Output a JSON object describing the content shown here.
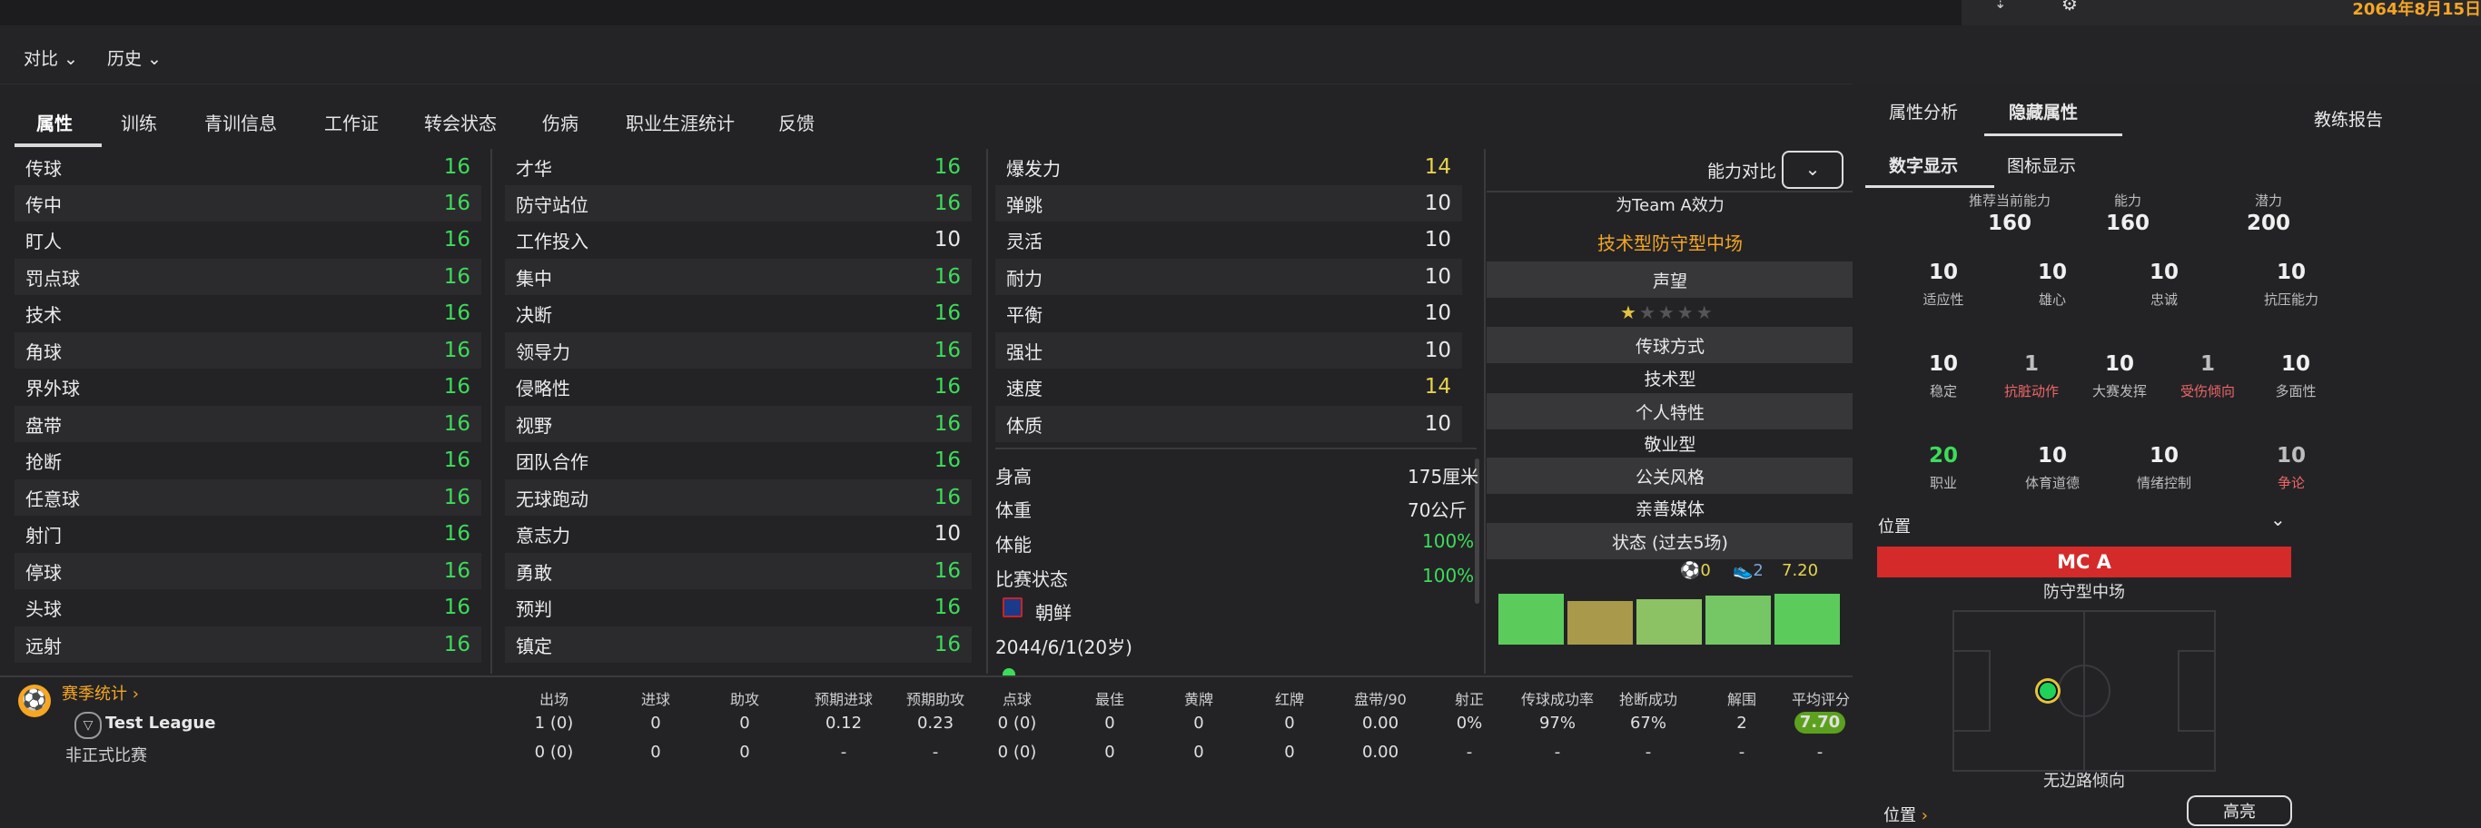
{
  "header": {
    "date": "2064年8月15日"
  },
  "subnav": {
    "compare": "对比",
    "history": "历史"
  },
  "tabs": [
    "属性",
    "训练",
    "青训信息",
    "工作证",
    "转会状态",
    "伤病",
    "职业生涯统计",
    "反馈"
  ],
  "attr_col1": [
    [
      "传球",
      "16"
    ],
    [
      "传中",
      "16"
    ],
    [
      "盯人",
      "16"
    ],
    [
      "罚点球",
      "16"
    ],
    [
      "技术",
      "16"
    ],
    [
      "角球",
      "16"
    ],
    [
      "界外球",
      "16"
    ],
    [
      "盘带",
      "16"
    ],
    [
      "抢断",
      "16"
    ],
    [
      "任意球",
      "16"
    ],
    [
      "射门",
      "16"
    ],
    [
      "停球",
      "16"
    ],
    [
      "头球",
      "16"
    ],
    [
      "远射",
      "16"
    ]
  ],
  "attr_col2": [
    [
      "才华",
      "16"
    ],
    [
      "防守站位",
      "16"
    ],
    [
      "工作投入",
      "10"
    ],
    [
      "集中",
      "16"
    ],
    [
      "决断",
      "16"
    ],
    [
      "领导力",
      "16"
    ],
    [
      "侵略性",
      "16"
    ],
    [
      "视野",
      "16"
    ],
    [
      "团队合作",
      "16"
    ],
    [
      "无球跑动",
      "16"
    ],
    [
      "意志力",
      "10"
    ],
    [
      "勇敢",
      "16"
    ],
    [
      "预判",
      "16"
    ],
    [
      "镇定",
      "16"
    ]
  ],
  "attr_col3": [
    [
      "爆发力",
      "14"
    ],
    [
      "弹跳",
      "10"
    ],
    [
      "灵活",
      "10"
    ],
    [
      "耐力",
      "10"
    ],
    [
      "平衡",
      "10"
    ],
    [
      "强壮",
      "10"
    ],
    [
      "速度",
      "14"
    ],
    [
      "体质",
      "10"
    ]
  ],
  "physical": {
    "height_label": "身高",
    "height": "175厘米",
    "weight_label": "体重",
    "weight": "70公斤",
    "fitness_label": "体能",
    "fitness": "100%",
    "match_label": "比赛状态",
    "match": "100%",
    "nation": "朝鲜",
    "dob": "2044/6/1(20岁)"
  },
  "panel": {
    "compare_label": "能力对比",
    "team_line": "为Team A效力",
    "role": "技术型防守型中场",
    "rep_label": "声望",
    "pass_label": "传球方式",
    "pass_value": "技术型",
    "trait_label": "个人特性",
    "trait_value": "敬业型",
    "media_label": "公关风格",
    "media_value": "亲善媒体",
    "form_label": "状态 (过去5场)",
    "form_goals": "0",
    "form_assists": "2",
    "form_rating": "7.20",
    "reputation_stars": 0.5,
    "form_bars": [
      0.7,
      0.55,
      0.6,
      0.65,
      0.7
    ]
  },
  "right": {
    "tab_attr_analysis": "属性分析",
    "tab_hidden": "隐藏属性",
    "coach_report": "教练报告",
    "sub_num": "数字显示",
    "sub_icon": "图标显示",
    "ca_label": "推荐当前能力",
    "ca": "160",
    "ability_label": "能力",
    "ability": "160",
    "potential_label": "潜力",
    "potential": "200",
    "hidden": [
      [
        "10",
        "适应性"
      ],
      [
        "10",
        "雄心"
      ],
      [
        "10",
        "忠诚"
      ],
      [
        "10",
        "抗压能力"
      ],
      [
        "10",
        "稳定"
      ],
      [
        "1",
        "抗脏动作"
      ],
      [
        "10",
        "大赛发挥"
      ],
      [
        "1",
        "受伤倾向"
      ],
      [
        "10",
        "多面性"
      ],
      [
        "20",
        "职业"
      ],
      [
        "10",
        "体育道德"
      ],
      [
        "10",
        "情绪控制"
      ],
      [
        "10",
        "争论"
      ]
    ],
    "position_label": "位置",
    "position_code": "MC A",
    "position_name": "防守型中场",
    "side_tendency": "无边路倾向",
    "position_footer": "位置",
    "footer_btn": "高亮"
  },
  "season": {
    "title": "赛季统计",
    "headers": [
      "出场",
      "进球",
      "助攻",
      "预期进球",
      "预期助攻",
      "点球",
      "最佳",
      "黄牌",
      "红牌",
      "盘带/90",
      "射正",
      "传球成功率",
      "抢断成功",
      "解围",
      "平均评分"
    ],
    "rows": [
      {
        "name": "Test League",
        "vals": [
          "1 (0)",
          "0",
          "0",
          "0.12",
          "0.23",
          "0 (0)",
          "0",
          "0",
          "0",
          "0.00",
          "0%",
          "97%",
          "67%",
          "2",
          "7.70"
        ]
      },
      {
        "name": "非正式比赛",
        "vals": [
          "0 (0)",
          "0",
          "0",
          "-",
          "-",
          "0 (0)",
          "0",
          "0",
          "0",
          "0.00",
          "-",
          "-",
          "-",
          "-",
          "-"
        ]
      }
    ]
  },
  "colors": {
    "green": "#3ddc5a",
    "yellow": "#e5d44d",
    "orange": "#f5a623",
    "red": "#d42a2a"
  }
}
